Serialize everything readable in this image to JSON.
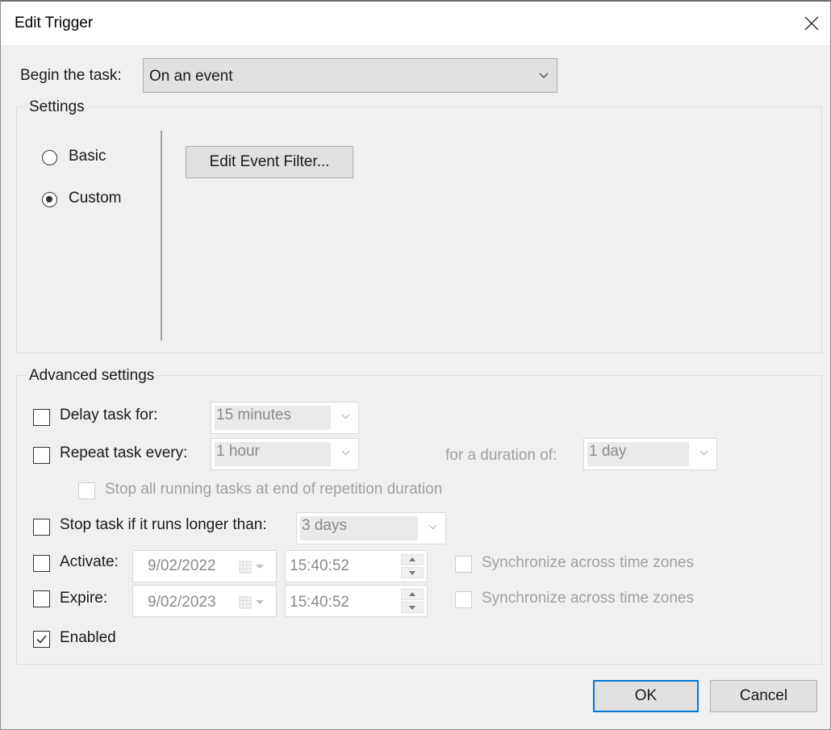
{
  "window": {
    "title": "Edit Trigger",
    "close_icon": "close-icon"
  },
  "begin_task": {
    "label": "Begin the task:",
    "value": "On an event"
  },
  "settings": {
    "title": "Settings",
    "radios": [
      {
        "label": "Basic",
        "checked": false
      },
      {
        "label": "Custom",
        "checked": true
      }
    ],
    "edit_filter_button": "Edit Event Filter..."
  },
  "advanced": {
    "title": "Advanced settings",
    "delay": {
      "label": "Delay task for:",
      "checked": false,
      "value": "15 minutes"
    },
    "repeat": {
      "label": "Repeat task every:",
      "checked": false,
      "value": "1 hour",
      "duration_label": "for a duration of:",
      "duration_value": "1 day"
    },
    "stop_all": {
      "label": "Stop all running tasks at end of repetition duration",
      "checked": false,
      "disabled": true
    },
    "stop_longer": {
      "label": "Stop task if it runs longer than:",
      "checked": false,
      "value": "3 days"
    },
    "activate": {
      "label": "Activate:",
      "checked": false,
      "date": "9/02/2022",
      "time": "15:40:52",
      "sync_label": "Synchronize across time zones",
      "sync_checked": false
    },
    "expire": {
      "label": "Expire:",
      "checked": false,
      "date": "9/02/2023",
      "time": "15:40:52",
      "sync_label": "Synchronize across time zones",
      "sync_checked": false
    },
    "enabled": {
      "label": "Enabled",
      "checked": true
    }
  },
  "buttons": {
    "ok": "OK",
    "cancel": "Cancel"
  },
  "colors": {
    "accent": "#0078d7",
    "background": "#f0f0f0",
    "disabled_text": "#a0a0a0"
  }
}
